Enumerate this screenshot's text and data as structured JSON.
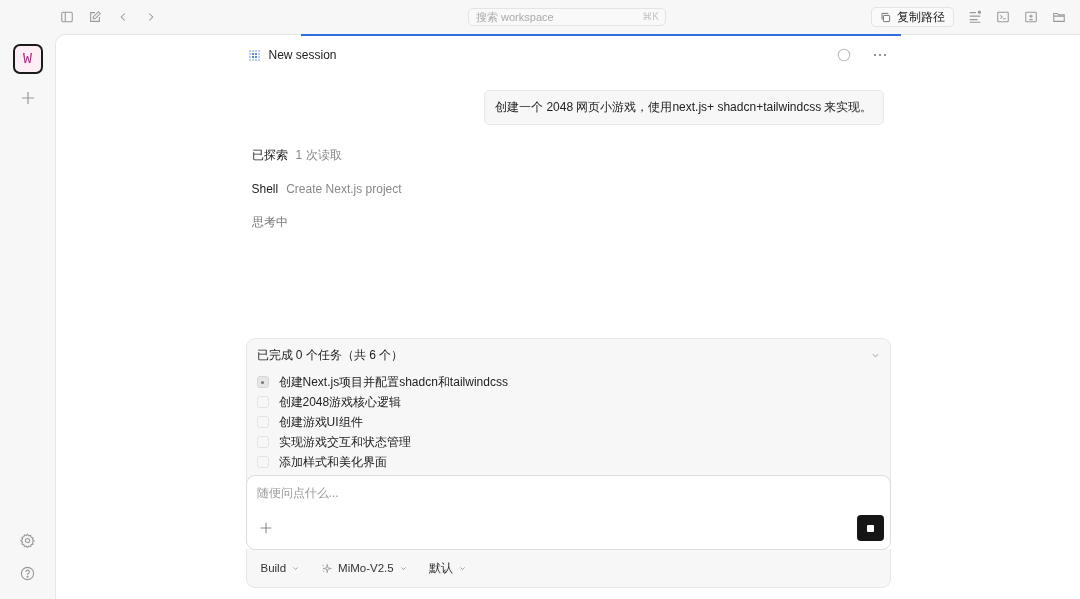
{
  "toolbar": {
    "search": {
      "placeholder": "搜索 workspace",
      "shortcut": "⌘K"
    },
    "copy_path": "复制路径"
  },
  "workspace": {
    "letter": "W",
    "selected": true
  },
  "session": {
    "title": "New session"
  },
  "user_message": "创建一个 2048 网页小游戏，使用next.js+ shadcn+tailwindcss 来实现。",
  "activity": [
    {
      "kind": "explored",
      "label": "已探索",
      "detail": "1 次读取"
    },
    {
      "kind": "tool",
      "label": "Shell",
      "detail": "Create Next.js project"
    },
    {
      "kind": "status",
      "label": "思考中"
    }
  ],
  "tasks": {
    "summary": "已完成 0 个任务（共 6 个）",
    "expanded": true,
    "items": [
      {
        "label": "创建Next.js项目并配置shadcn和tailwindcss",
        "in_progress": true
      },
      {
        "label": "创建2048游戏核心逻辑",
        "in_progress": false
      },
      {
        "label": "创建游戏UI组件",
        "in_progress": false
      },
      {
        "label": "实现游戏交互和状态管理",
        "in_progress": false
      },
      {
        "label": "添加样式和美化界面",
        "in_progress": false
      }
    ]
  },
  "composer": {
    "placeholder": "随便问点什么..."
  },
  "options": [
    {
      "kind": "mode",
      "label": "Build"
    },
    {
      "kind": "model",
      "label": "MiMo-V2.5"
    },
    {
      "kind": "variant",
      "label": "默认"
    }
  ]
}
